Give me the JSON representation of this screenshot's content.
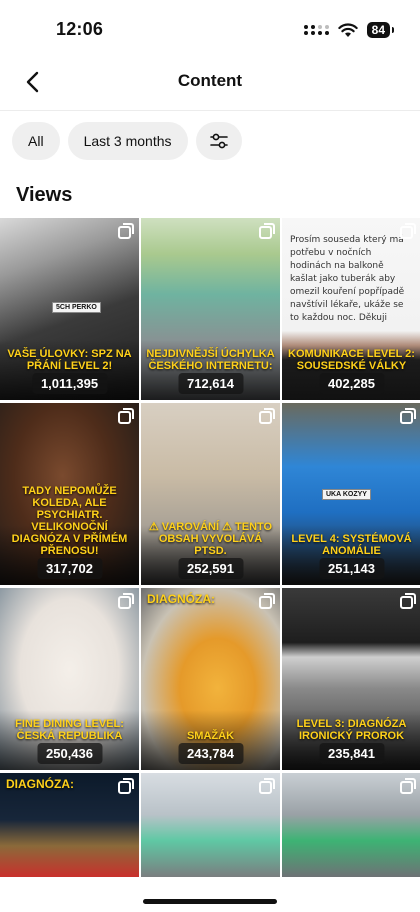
{
  "status_bar": {
    "time": "12:06",
    "battery": "84"
  },
  "header": {
    "title": "Content"
  },
  "filters": {
    "all_label": "All",
    "range_label": "Last 3 months"
  },
  "section": {
    "title": "Views"
  },
  "tiles": [
    {
      "caption": "VAŠE ÚLOVKY: SPZ NA PŘÁNÍ LEVEL 2!",
      "views": "1,011,395"
    },
    {
      "caption": "NEJDIVNĚJŠÍ ÚCHYLKA ČESKÉHO INTERNETU:",
      "views": "712,614"
    },
    {
      "caption": "KOMUNIKACE LEVEL 2: SOUSEDSKÉ VÁLKY",
      "views": "402,285",
      "note": "Prosím souseda který má potřebu v nočních hodinách na balkoně kašlat jako tuberák aby omezil kouření popřípadě navštívil lékaře, ukáže se to každou noc. Děkuji"
    },
    {
      "caption": "TADY NEPOMŮŽE KOLEDA, ALE PSYCHIATR. VELIKONOČNÍ DIAGNÓZA V PŘÍMÉM PŘENOSU!",
      "views": "317,702"
    },
    {
      "caption": "⚠ VAROVÁNÍ ⚠ TENTO OBSAH VYVOLÁVÁ PTSD.",
      "views": "252,591"
    },
    {
      "caption": "LEVEL 4: SYSTÉMOVÁ ANOMÁLIE",
      "views": "251,143",
      "plate": "UKA KOZYY"
    },
    {
      "caption": "FINE DINING LEVEL: ČESKÁ REPUBLIKA",
      "views": "250,436"
    },
    {
      "caption": "SMAŽÁK",
      "views": "243,784",
      "top_label": "DIAGNÓZA:"
    },
    {
      "caption": "LEVEL 3: DIAGNÓZA IRONICKÝ PROROK",
      "views": "235,841"
    },
    {
      "top_label": "DIAGNÓZA:"
    },
    {},
    {}
  ]
}
